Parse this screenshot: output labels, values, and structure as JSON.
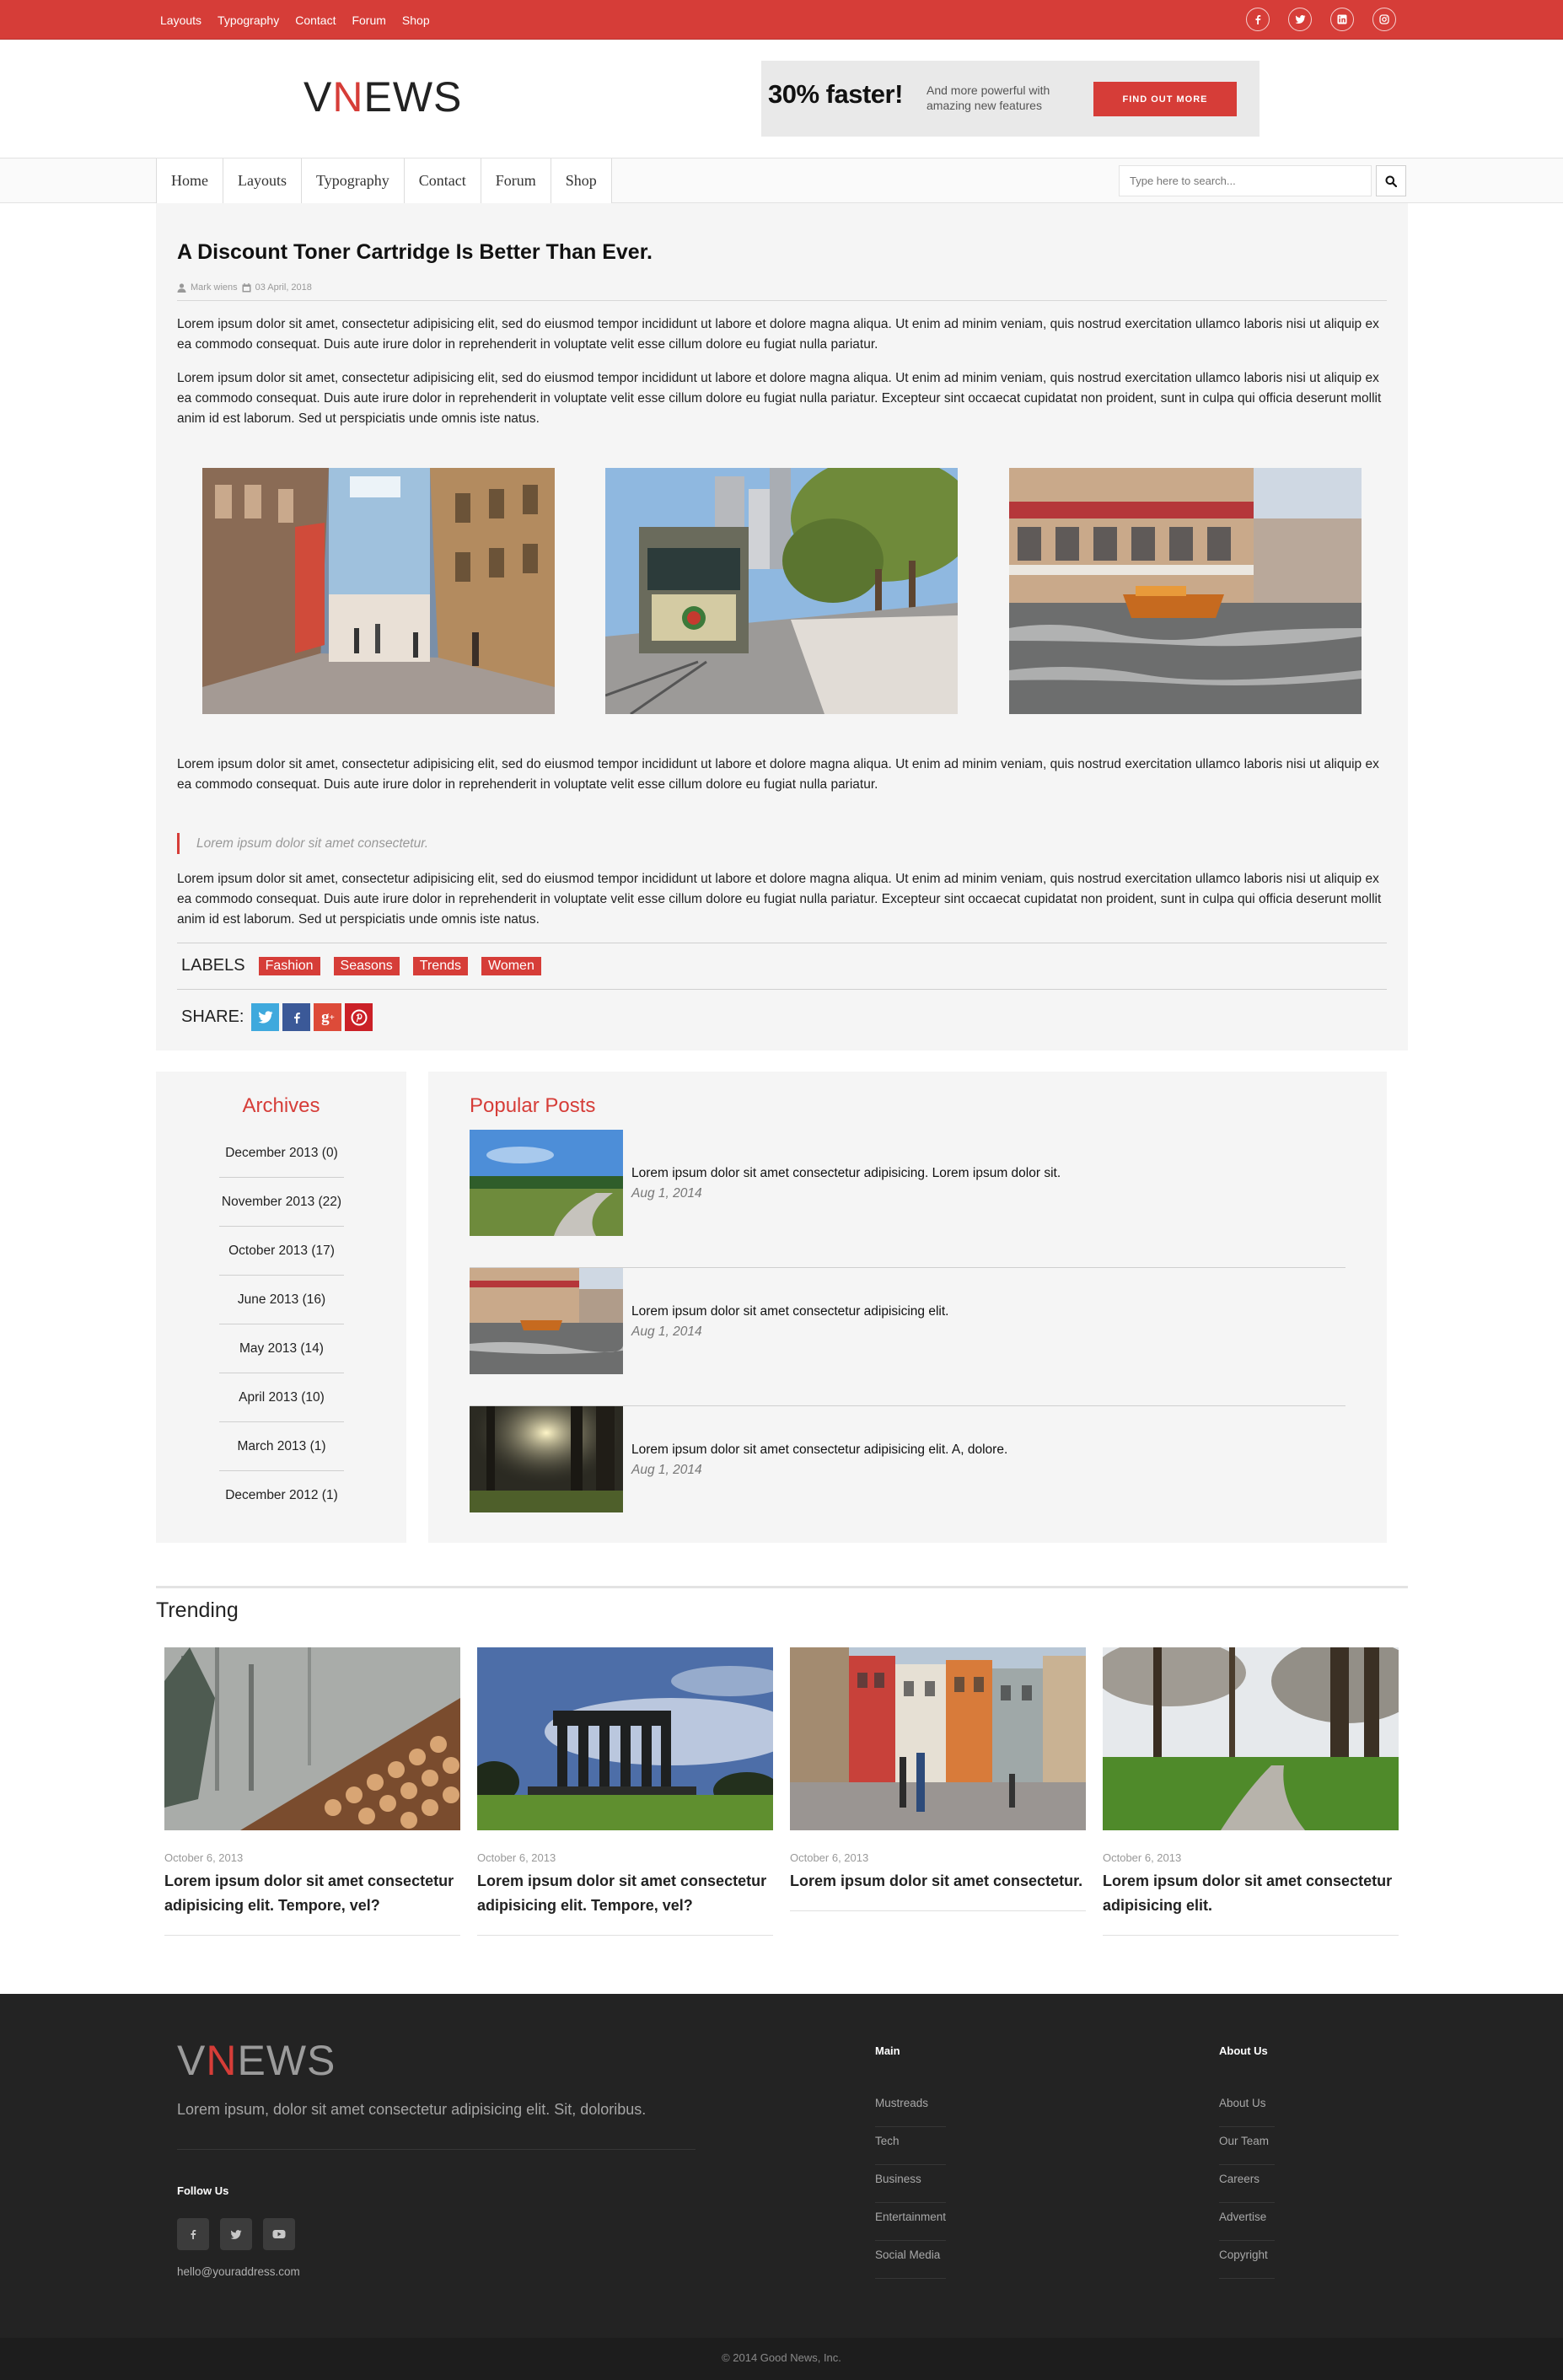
{
  "topbar": {
    "links": [
      "Layouts",
      "Typography",
      "Contact",
      "Forum",
      "Shop"
    ],
    "social_icons": [
      "facebook-icon",
      "twitter-icon",
      "linkedin-icon",
      "instagram-icon"
    ]
  },
  "brand": {
    "logo_part1": "V",
    "logo_accent": "N",
    "logo_part2": "EWS"
  },
  "ad": {
    "headline": "30% faster!",
    "text": "And more powerful with amazing new features",
    "button": "FIND OUT MORE"
  },
  "nav": {
    "items": [
      "Home",
      "Layouts",
      "Typography",
      "Contact",
      "Forum",
      "Shop"
    ],
    "search_placeholder": "Type here to search..."
  },
  "article": {
    "title": "A Discount Toner Cartridge Is Better Than Ever.",
    "author": "Mark wiens",
    "date": "03 April, 2018",
    "p1": "Lorem ipsum dolor sit amet, consectetur adipisicing elit, sed do eiusmod tempor incididunt ut labore et dolore magna aliqua. Ut enim ad minim veniam, quis nostrud exercitation ullamco laboris nisi ut aliquip ex ea commodo consequat. Duis aute irure dolor in reprehenderit in voluptate velit esse cillum dolore eu fugiat nulla pariatur.",
    "p2": "Lorem ipsum dolor sit amet, consectetur adipisicing elit, sed do eiusmod tempor incididunt ut labore et dolore magna aliqua. Ut enim ad minim veniam, quis nostrud exercitation ullamco laboris nisi ut aliquip ex ea commodo consequat. Duis aute irure dolor in reprehenderit in voluptate velit esse cillum dolore eu fugiat nulla pariatur. Excepteur sint occaecat cupidatat non proident, sunt in culpa qui officia deserunt mollit anim id est laborum. Sed ut perspiciatis unde omnis iste natus.",
    "p3": "Lorem ipsum dolor sit amet, consectetur adipisicing elit, sed do eiusmod tempor incididunt ut labore et dolore magna aliqua. Ut enim ad minim veniam, quis nostrud exercitation ullamco laboris nisi ut aliquip ex ea commodo consequat. Duis aute irure dolor in reprehenderit in voluptate velit esse cillum dolore eu fugiat nulla pariatur.",
    "quote": "Lorem ipsum dolor sit amet consectetur.",
    "p4": "Lorem ipsum dolor sit amet, consectetur adipisicing elit, sed do eiusmod tempor incididunt ut labore et dolore magna aliqua. Ut enim ad minim veniam, quis nostrud exercitation ullamco laboris nisi ut aliquip ex ea commodo consequat. Duis aute irure dolor in reprehenderit in voluptate velit esse cillum dolore eu fugiat nulla pariatur. Excepteur sint occaecat cupidatat non proident, sunt in culpa qui officia deserunt mollit anim id est laborum. Sed ut perspiciatis unde omnis iste natus.",
    "labels_heading": "LABELS",
    "labels": [
      "Fashion",
      "Seasons",
      "Trends",
      "Women"
    ],
    "share_heading": "SHARE:",
    "share_icons": [
      "twitter-icon",
      "facebook-icon",
      "google-plus-icon",
      "pinterest-icon"
    ]
  },
  "archives": {
    "heading": "Archives",
    "items": [
      "December 2013 (0)",
      "November 2013 (22)",
      "October 2013 (17)",
      "June 2013 (16)",
      "May 2013 (14)",
      "April 2013 (10)",
      "March 2013 (1)",
      "December 2012 (1)"
    ]
  },
  "popular": {
    "heading": "Popular Posts",
    "posts": [
      {
        "title": "Lorem ipsum dolor sit amet consectetur adipisicing. Lorem ipsum dolor sit.",
        "date": "Aug 1, 2014"
      },
      {
        "title": "Lorem ipsum dolor sit amet consectetur adipisicing elit.",
        "date": "Aug 1, 2014"
      },
      {
        "title": "Lorem ipsum dolor sit amet consectetur adipisicing elit. A, dolore.",
        "date": "Aug 1, 2014"
      }
    ]
  },
  "trending": {
    "heading": "Trending",
    "cards": [
      {
        "date": "October 6, 2013",
        "title": "Lorem ipsum dolor sit amet consectetur adipisicing elit. Tempore, vel?"
      },
      {
        "date": "October 6, 2013",
        "title": "Lorem ipsum dolor sit amet consectetur adipisicing elit. Tempore, vel?"
      },
      {
        "date": "October 6, 2013",
        "title": "Lorem ipsum dolor sit amet consectetur."
      },
      {
        "date": "October 6, 2013",
        "title": "Lorem ipsum dolor sit amet consectetur adipisicing elit."
      }
    ]
  },
  "footer": {
    "description": "Lorem ipsum, dolor sit amet consectetur adipisicing elit. Sit, doloribus.",
    "follow_heading": "Follow Us",
    "email": "hello@youraddress.com",
    "main_heading": "Main",
    "main_links": [
      "Mustreads",
      "Tech",
      "Business",
      "Entertainment",
      "Social Media"
    ],
    "about_heading": "About Us",
    "about_links": [
      "About Us",
      "Our Team",
      "Careers",
      "Advertise",
      "Copyright"
    ],
    "copyright": "© 2014 Good News, Inc."
  },
  "colors": {
    "accent": "#d63d38",
    "footer_bg": "#232323",
    "panel_bg": "#f5f5f5"
  }
}
